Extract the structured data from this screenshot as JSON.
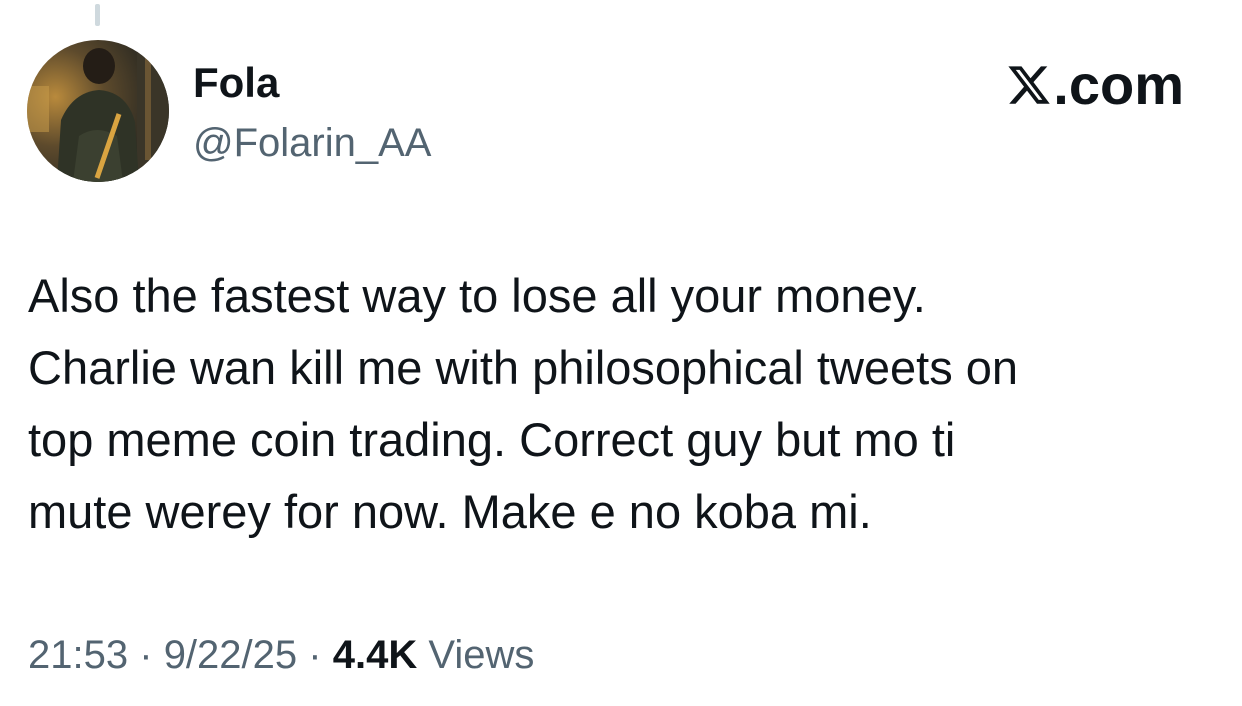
{
  "tweet": {
    "author": {
      "display_name": "Fola",
      "handle": "@Folarin_AA",
      "avatar": "profile-photo"
    },
    "brand": {
      "logo": "x-logo-icon",
      "label": ".com"
    },
    "text_lines": [
      "Also the fastest way to lose all your money.",
      "Charlie wan kill me with philosophical tweets on",
      "top meme coin trading. Correct guy but mo ti",
      "mute werey for now. Make e no koba mi."
    ],
    "meta": {
      "time": "21:53",
      "separator": "·",
      "date": "9/22/25",
      "view_count": "4.4K",
      "views_label": "Views"
    }
  },
  "colors": {
    "text_primary": "#0f1419",
    "text_secondary": "#536471",
    "thread_line": "#cfd9de",
    "background": "#ffffff"
  }
}
